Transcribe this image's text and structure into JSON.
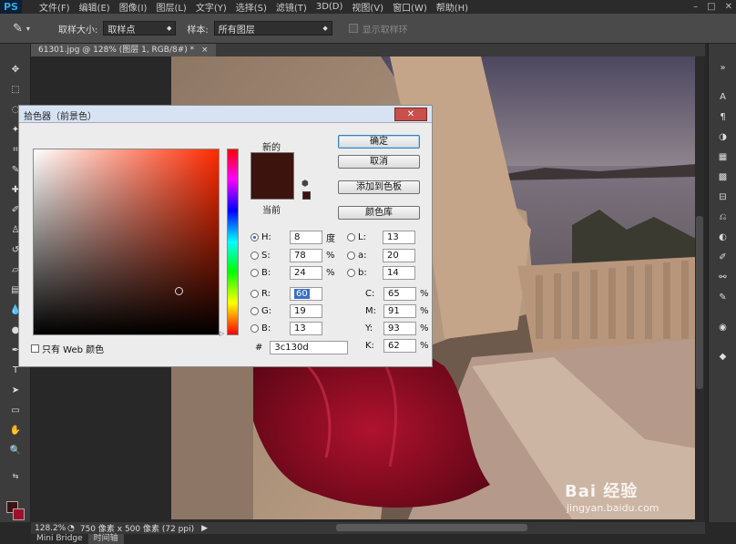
{
  "menu": {
    "logo": "PS",
    "items": [
      "文件(F)",
      "编辑(E)",
      "图像(I)",
      "图层(L)",
      "文字(Y)",
      "选择(S)",
      "滤镜(T)",
      "3D(D)",
      "视图(V)",
      "窗口(W)",
      "帮助(H)"
    ],
    "window_controls": [
      "–",
      "□",
      "✕"
    ]
  },
  "options": {
    "sample_size_label": "取样大小:",
    "sample_size_value": "取样点",
    "sample_label": "样本:",
    "sample_value": "所有图层",
    "show_ring_label": "显示取样环"
  },
  "document": {
    "tab_title": "61301.jpg @ 128% (图层 1, RGB/8#) *",
    "tab_close": "×"
  },
  "status": {
    "zoom": "128.2%",
    "doc_info": "750 像素 x 500 像素 (72 ppi)"
  },
  "bottom_tabs": [
    "Mini Bridge",
    "时间轴"
  ],
  "dialog": {
    "title": "拾色器（前景色）",
    "close": "✕",
    "new_label": "新的",
    "current_label": "当前",
    "buttons": {
      "ok": "确定",
      "cancel": "取消",
      "add_swatch": "添加到色板",
      "libraries": "颜色库"
    },
    "fields": {
      "H": {
        "label": "H:",
        "value": "8",
        "unit": "度"
      },
      "S": {
        "label": "S:",
        "value": "78",
        "unit": "%"
      },
      "Bv": {
        "label": "B:",
        "value": "24",
        "unit": "%"
      },
      "R": {
        "label": "R:",
        "value": "60"
      },
      "G": {
        "label": "G:",
        "value": "19"
      },
      "Bb": {
        "label": "B:",
        "value": "13"
      },
      "L": {
        "label": "L:",
        "value": "13"
      },
      "a": {
        "label": "a:",
        "value": "20"
      },
      "b": {
        "label": "b:",
        "value": "14"
      },
      "C": {
        "label": "C:",
        "value": "65",
        "unit": "%"
      },
      "M": {
        "label": "M:",
        "value": "91",
        "unit": "%"
      },
      "Y": {
        "label": "Y:",
        "value": "93",
        "unit": "%"
      },
      "K": {
        "label": "K:",
        "value": "62",
        "unit": "%"
      }
    },
    "hex_label": "#",
    "hex_value": "3c130d",
    "web_only_label": "只有 Web 颜色",
    "selected_color": "#3c130d"
  },
  "watermark": {
    "brand": "Bai 经验",
    "url": "jingyan.baidu.com"
  }
}
